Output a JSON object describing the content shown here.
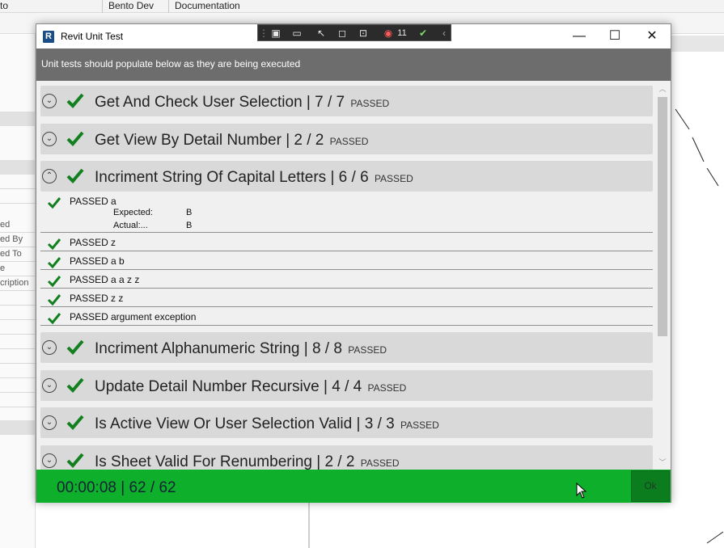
{
  "background_app": {
    "top_menu": [
      "to",
      "Bento Dev",
      "Documentation"
    ],
    "left_labels": [
      "ed",
      "ed By",
      "ed To",
      "e",
      "cription"
    ]
  },
  "window": {
    "title": "Revit Unit Test",
    "app_icon_letter": "R",
    "minimize_glyph": "—",
    "maximize_glyph": "☐",
    "close_glyph": "✕"
  },
  "floating_toolbar": {
    "badge_count": "11"
  },
  "header": {
    "message": "Unit tests should populate below as they are being executed"
  },
  "groups": [
    {
      "name": "Get And Check User Selection",
      "count": "7 / 7",
      "status": "PASSED",
      "expanded": false
    },
    {
      "name": "Get View By Detail Number",
      "count": "2 / 2",
      "status": "PASSED",
      "expanded": false
    },
    {
      "name": "Incriment String Of Capital Letters",
      "count": "6 / 6",
      "status": "PASSED",
      "expanded": true
    },
    {
      "name": "Incriment Alphanumeric String",
      "count": "8 / 8",
      "status": "PASSED",
      "expanded": false
    },
    {
      "name": "Update Detail Number Recursive",
      "count": "4 / 4",
      "status": "PASSED",
      "expanded": false
    },
    {
      "name": "Is Active View Or User Selection Valid",
      "count": "3 / 3",
      "status": "PASSED",
      "expanded": false
    },
    {
      "name": "Is Sheet Valid For Renumbering",
      "count": "2 / 2",
      "status": "PASSED",
      "expanded": false
    }
  ],
  "expanded_tests": [
    {
      "status": "PASSED",
      "name": "a",
      "expected_label": "Expected:",
      "expected": "B",
      "actual_label": "Actual:...",
      "actual": "B"
    },
    {
      "status": "PASSED",
      "name": "z"
    },
    {
      "status": "PASSED",
      "name": "a b"
    },
    {
      "status": "PASSED",
      "name": "a a z z"
    },
    {
      "status": "PASSED",
      "name": "z z"
    },
    {
      "status": "PASSED",
      "name": "argument exception"
    }
  ],
  "footer": {
    "elapsed": "00:00:08",
    "separator": "|",
    "total": "62 / 62",
    "ok_label": "Ok"
  },
  "colors": {
    "footer_green": "#0eaf2a",
    "check_green": "#12801f",
    "header_gray": "#6d6d6d",
    "group_gray": "#d9d9d9"
  }
}
